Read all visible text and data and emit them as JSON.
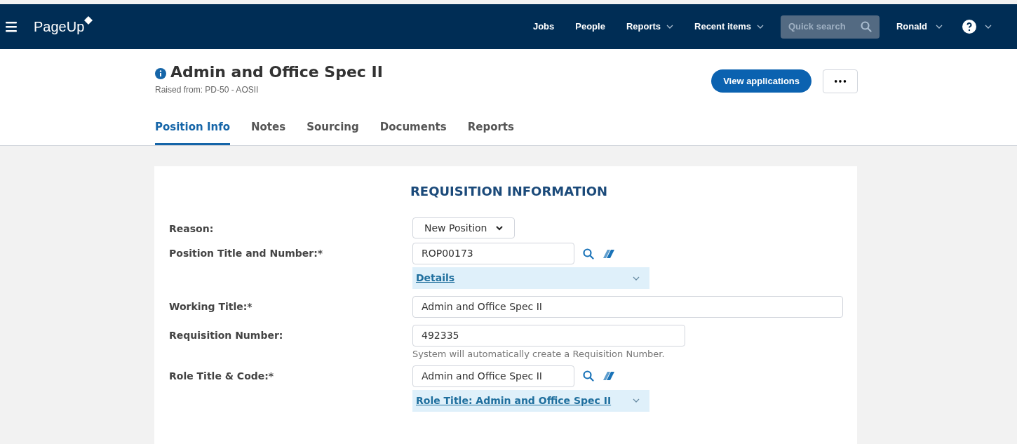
{
  "navbar": {
    "logo": "PageUp",
    "links": [
      {
        "label": "Jobs",
        "dropdown": false
      },
      {
        "label": "People",
        "dropdown": false
      },
      {
        "label": "Reports",
        "dropdown": true
      },
      {
        "label": "Recent items",
        "dropdown": true
      }
    ],
    "search": {
      "placeholder": "Quick search"
    },
    "user": {
      "label": "Ronald",
      "dropdown": true
    }
  },
  "header": {
    "title": "Admin and Office Spec II",
    "subtitle": "Raised from: PD-50 - AOSII",
    "primary_button": "View applications",
    "more_button": "•••"
  },
  "tabs": [
    {
      "label": "Position Info",
      "selected": true
    },
    {
      "label": "Notes",
      "selected": false
    },
    {
      "label": "Sourcing",
      "selected": false
    },
    {
      "label": "Documents",
      "selected": false
    },
    {
      "label": "Reports",
      "selected": false
    }
  ],
  "section": {
    "title": "REQUISITION INFORMATION",
    "fields": [
      {
        "kind": "select",
        "label": "Reason:",
        "value": "New Position"
      },
      {
        "kind": "lookup",
        "label": "Position Title and Number:*",
        "value": "ROP00173",
        "details": "Details"
      },
      {
        "kind": "text",
        "label": "Working Title:*",
        "value": "Admin and Office Spec II",
        "wide": true
      },
      {
        "kind": "text",
        "label": "Requisition Number:",
        "value": "492335",
        "wide": false,
        "hint": "System will automatically create a Requisition Number."
      },
      {
        "kind": "lookup",
        "label": "Role Title & Code:*",
        "value": "Admin and Office Spec II",
        "details": "Role Title: Admin and Office Spec II"
      }
    ]
  }
}
